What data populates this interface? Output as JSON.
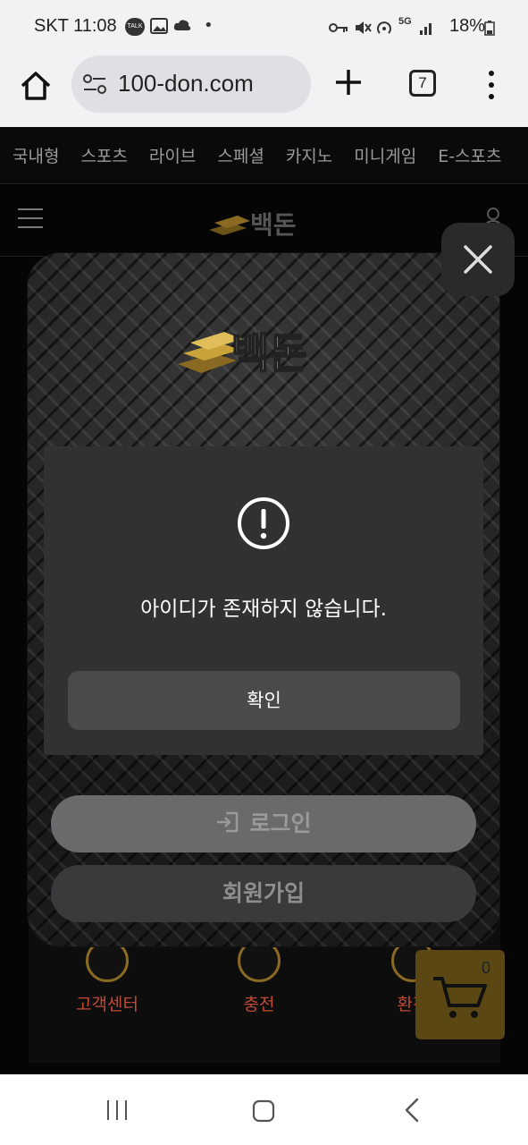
{
  "status_bar": {
    "carrier_time": "SKT 11:08",
    "talk_label": "TALK",
    "network": "5G",
    "battery": "18%"
  },
  "browser": {
    "url": "100-don.com",
    "tab_count": "7"
  },
  "site": {
    "nav_categories": [
      "국내형",
      "스포츠",
      "라이브",
      "스페셜",
      "카지노",
      "미니게임",
      "E-스포츠"
    ],
    "logo_text": "백돈"
  },
  "background": {
    "items": [
      "고객센터",
      "충전",
      "환전"
    ]
  },
  "modal": {
    "logo_text": "백돈",
    "alert": {
      "message": "아이디가 존재하지 않습니다.",
      "confirm_label": "확인"
    },
    "login_label": "로그인",
    "signup_label": "회원가입"
  },
  "cart": {
    "count": "0"
  },
  "colors": {
    "accent_gold": "#c9a23a",
    "alert_bg": "#313133",
    "modal_bg": "#242424"
  }
}
